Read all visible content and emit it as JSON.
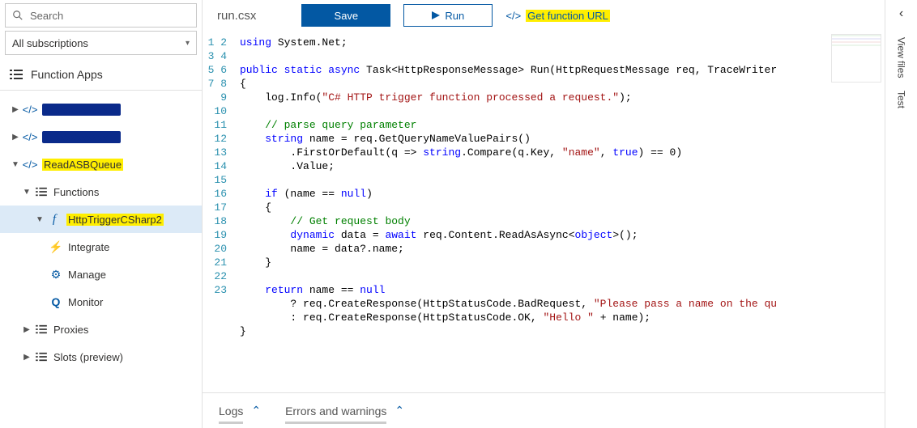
{
  "sidebar": {
    "search_placeholder": "Search",
    "subscriptions_label": "All subscriptions",
    "function_apps_label": "Function Apps",
    "nodes": {
      "app1_label": "xxxxxxxxxx",
      "app2_label": "xxxxxxxxxx",
      "app3_label": "ReadASBQueue",
      "functions_label": "Functions",
      "fn_label": "HttpTriggerCSharp2",
      "integrate_label": "Integrate",
      "manage_label": "Manage",
      "monitor_label": "Monitor",
      "proxies_label": "Proxies",
      "slots_label": "Slots (preview)"
    }
  },
  "toolbar": {
    "file_title": "run.csx",
    "save_label": "Save",
    "run_label": "Run",
    "get_url_label": "Get function URL"
  },
  "editor": {
    "line_count": 23
  },
  "bottom": {
    "logs_label": "Logs",
    "errors_label": "Errors and warnings"
  },
  "right": {
    "view_files_label": "View files",
    "test_label": "Test"
  }
}
